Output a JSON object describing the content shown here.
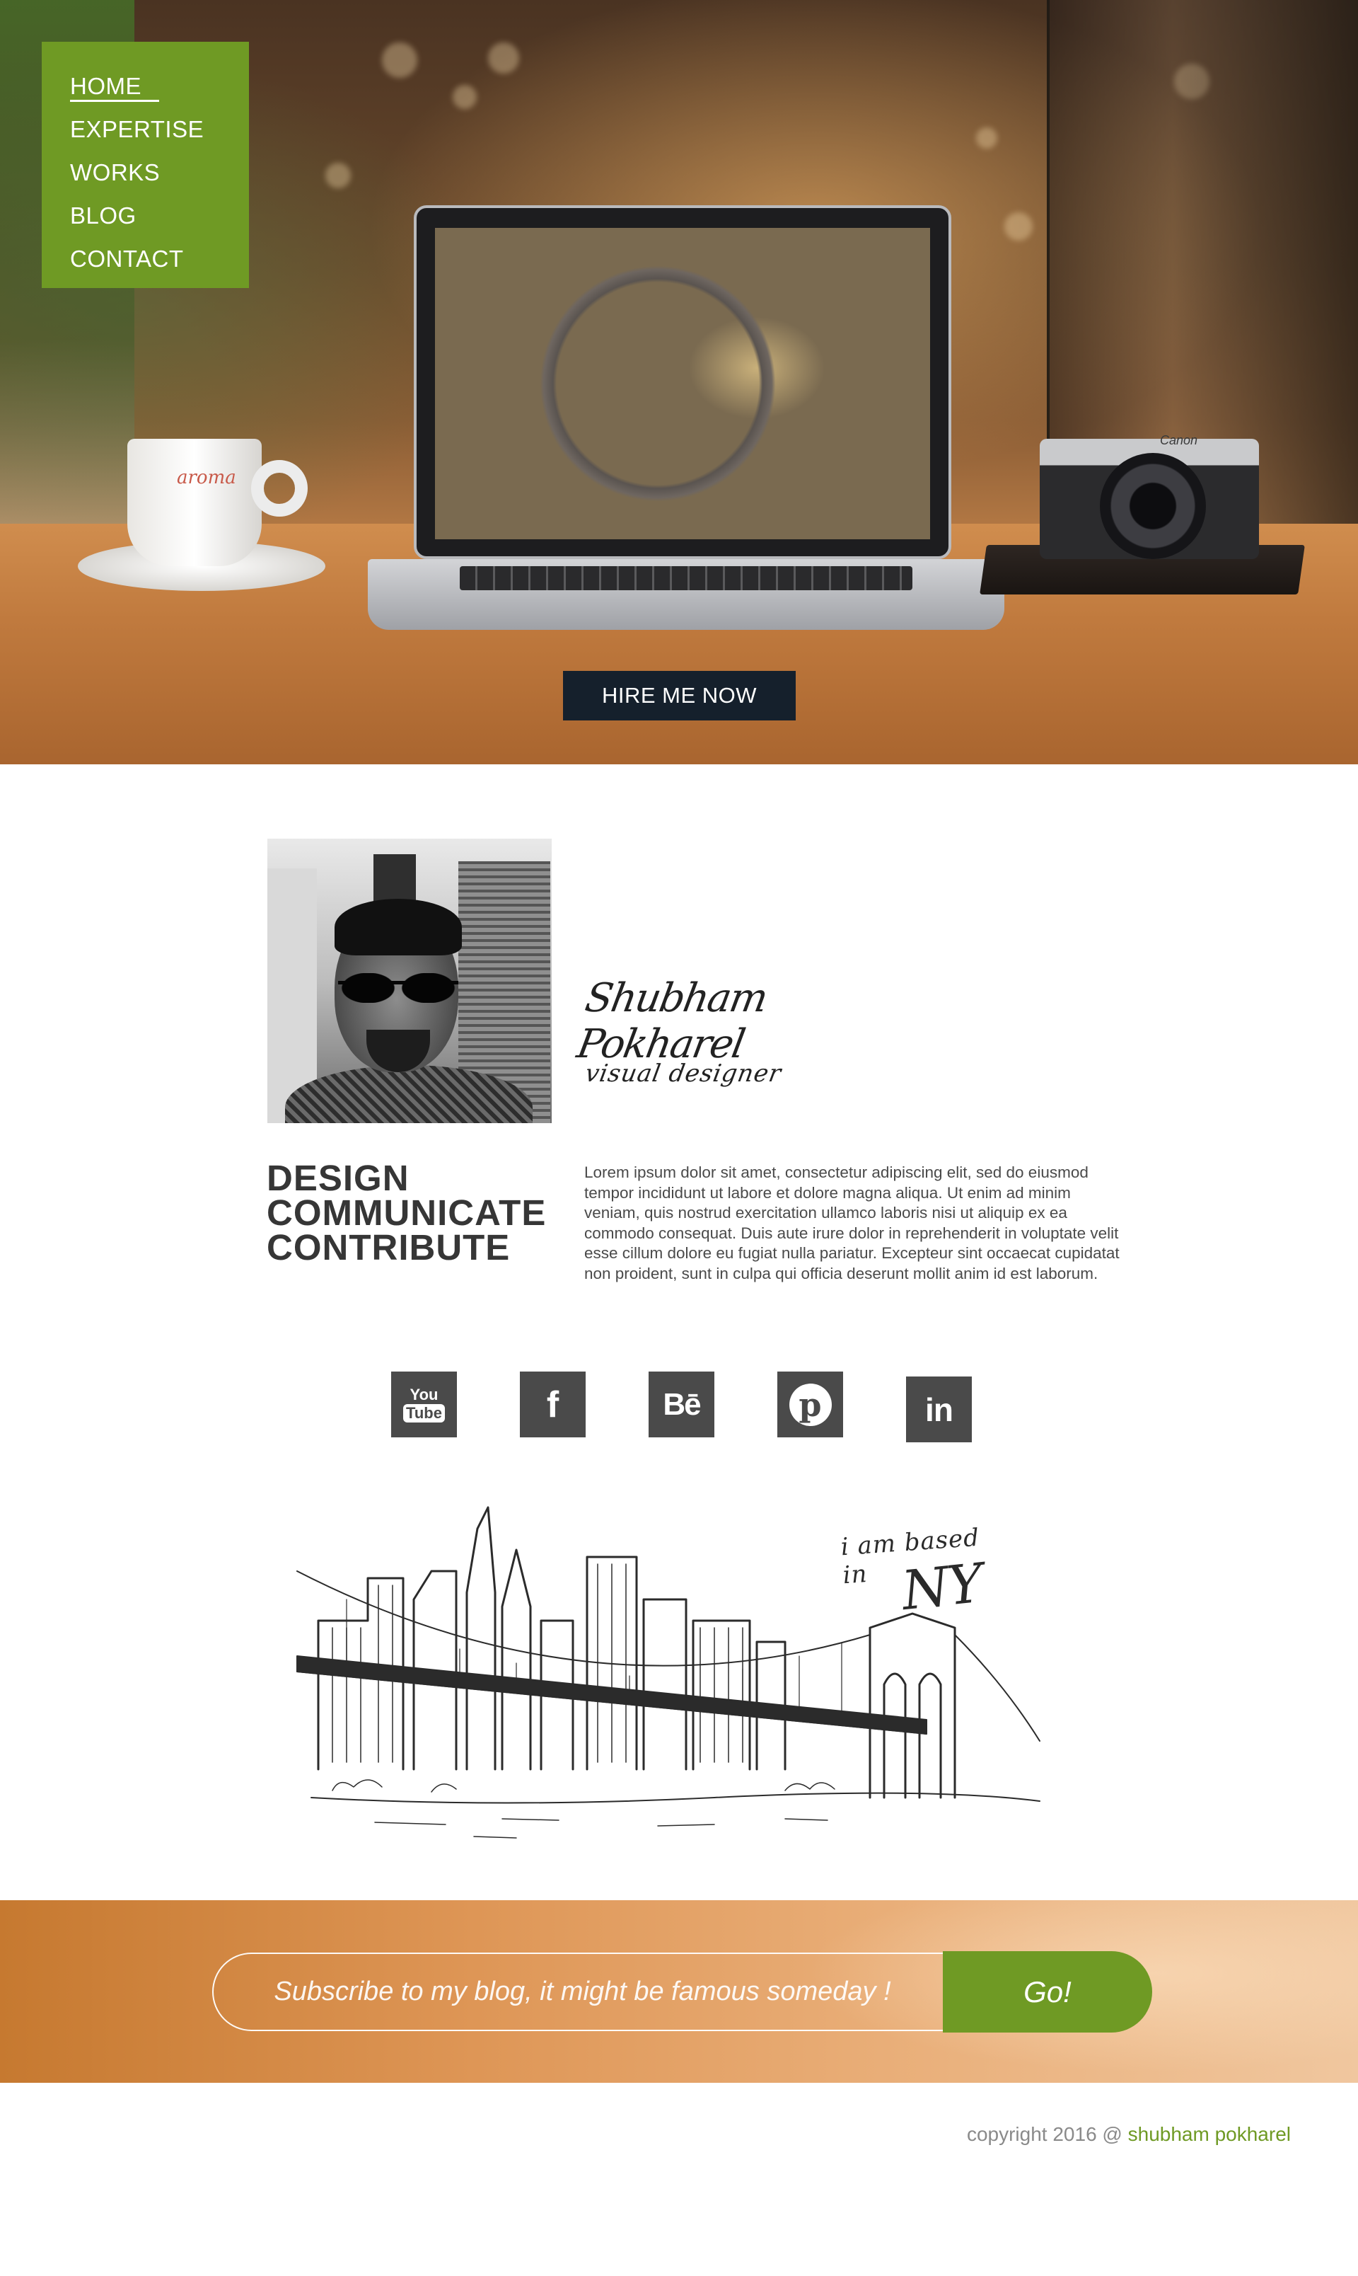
{
  "nav": {
    "items": [
      {
        "label": "HOME",
        "active": true
      },
      {
        "label": "EXPERTISE"
      },
      {
        "label": "WORKS"
      },
      {
        "label": "BLOG"
      },
      {
        "label": "CONTACT"
      }
    ]
  },
  "hero": {
    "cta_label": "HIRE ME NOW",
    "cup_brand": "aroma",
    "camera_brand": "Canon"
  },
  "about": {
    "signature": "Shubham Pokharel",
    "signature_subtitle": "visual designer",
    "tagline": [
      "DESIGN",
      "COMMUNICATE",
      "CONTRIBUTE"
    ],
    "bio": "Lorem ipsum dolor sit amet, consectetur adipiscing elit, sed do eiusmod tempor incididunt ut labore et dolore magna aliqua. Ut enim ad minim veniam, quis nostrud exercitation ullamco laboris nisi ut aliquip ex ea commodo consequat. Duis aute irure dolor in reprehenderit in voluptate velit esse cillum dolore eu fugiat nulla pariatur. Excepteur sint occaecat cupidatat non proident, sunt in culpa qui officia deserunt mollit anim id est laborum."
  },
  "social": {
    "youtube_top": "You",
    "youtube_bottom": "Tube",
    "facebook_glyph": "f",
    "behance_glyph": "Bē",
    "pinterest_glyph": "p",
    "linkedin_glyph": "in",
    "icons": [
      "youtube-icon",
      "facebook-icon",
      "behance-icon",
      "pinterest-icon",
      "linkedin-icon"
    ]
  },
  "location": {
    "caption": "i am based in",
    "city": "NY"
  },
  "subscribe": {
    "placeholder": "Subscribe to my blog, it might be famous someday !",
    "button_label": "Go!"
  },
  "footer": {
    "copyright_prefix": "copyright 2016 @ ",
    "author": "shubham pokharel"
  },
  "colors": {
    "accent_green": "#6f9a24",
    "dark_button": "#15202c",
    "social_gray": "#4a4a4a",
    "heading_text": "#363636"
  }
}
